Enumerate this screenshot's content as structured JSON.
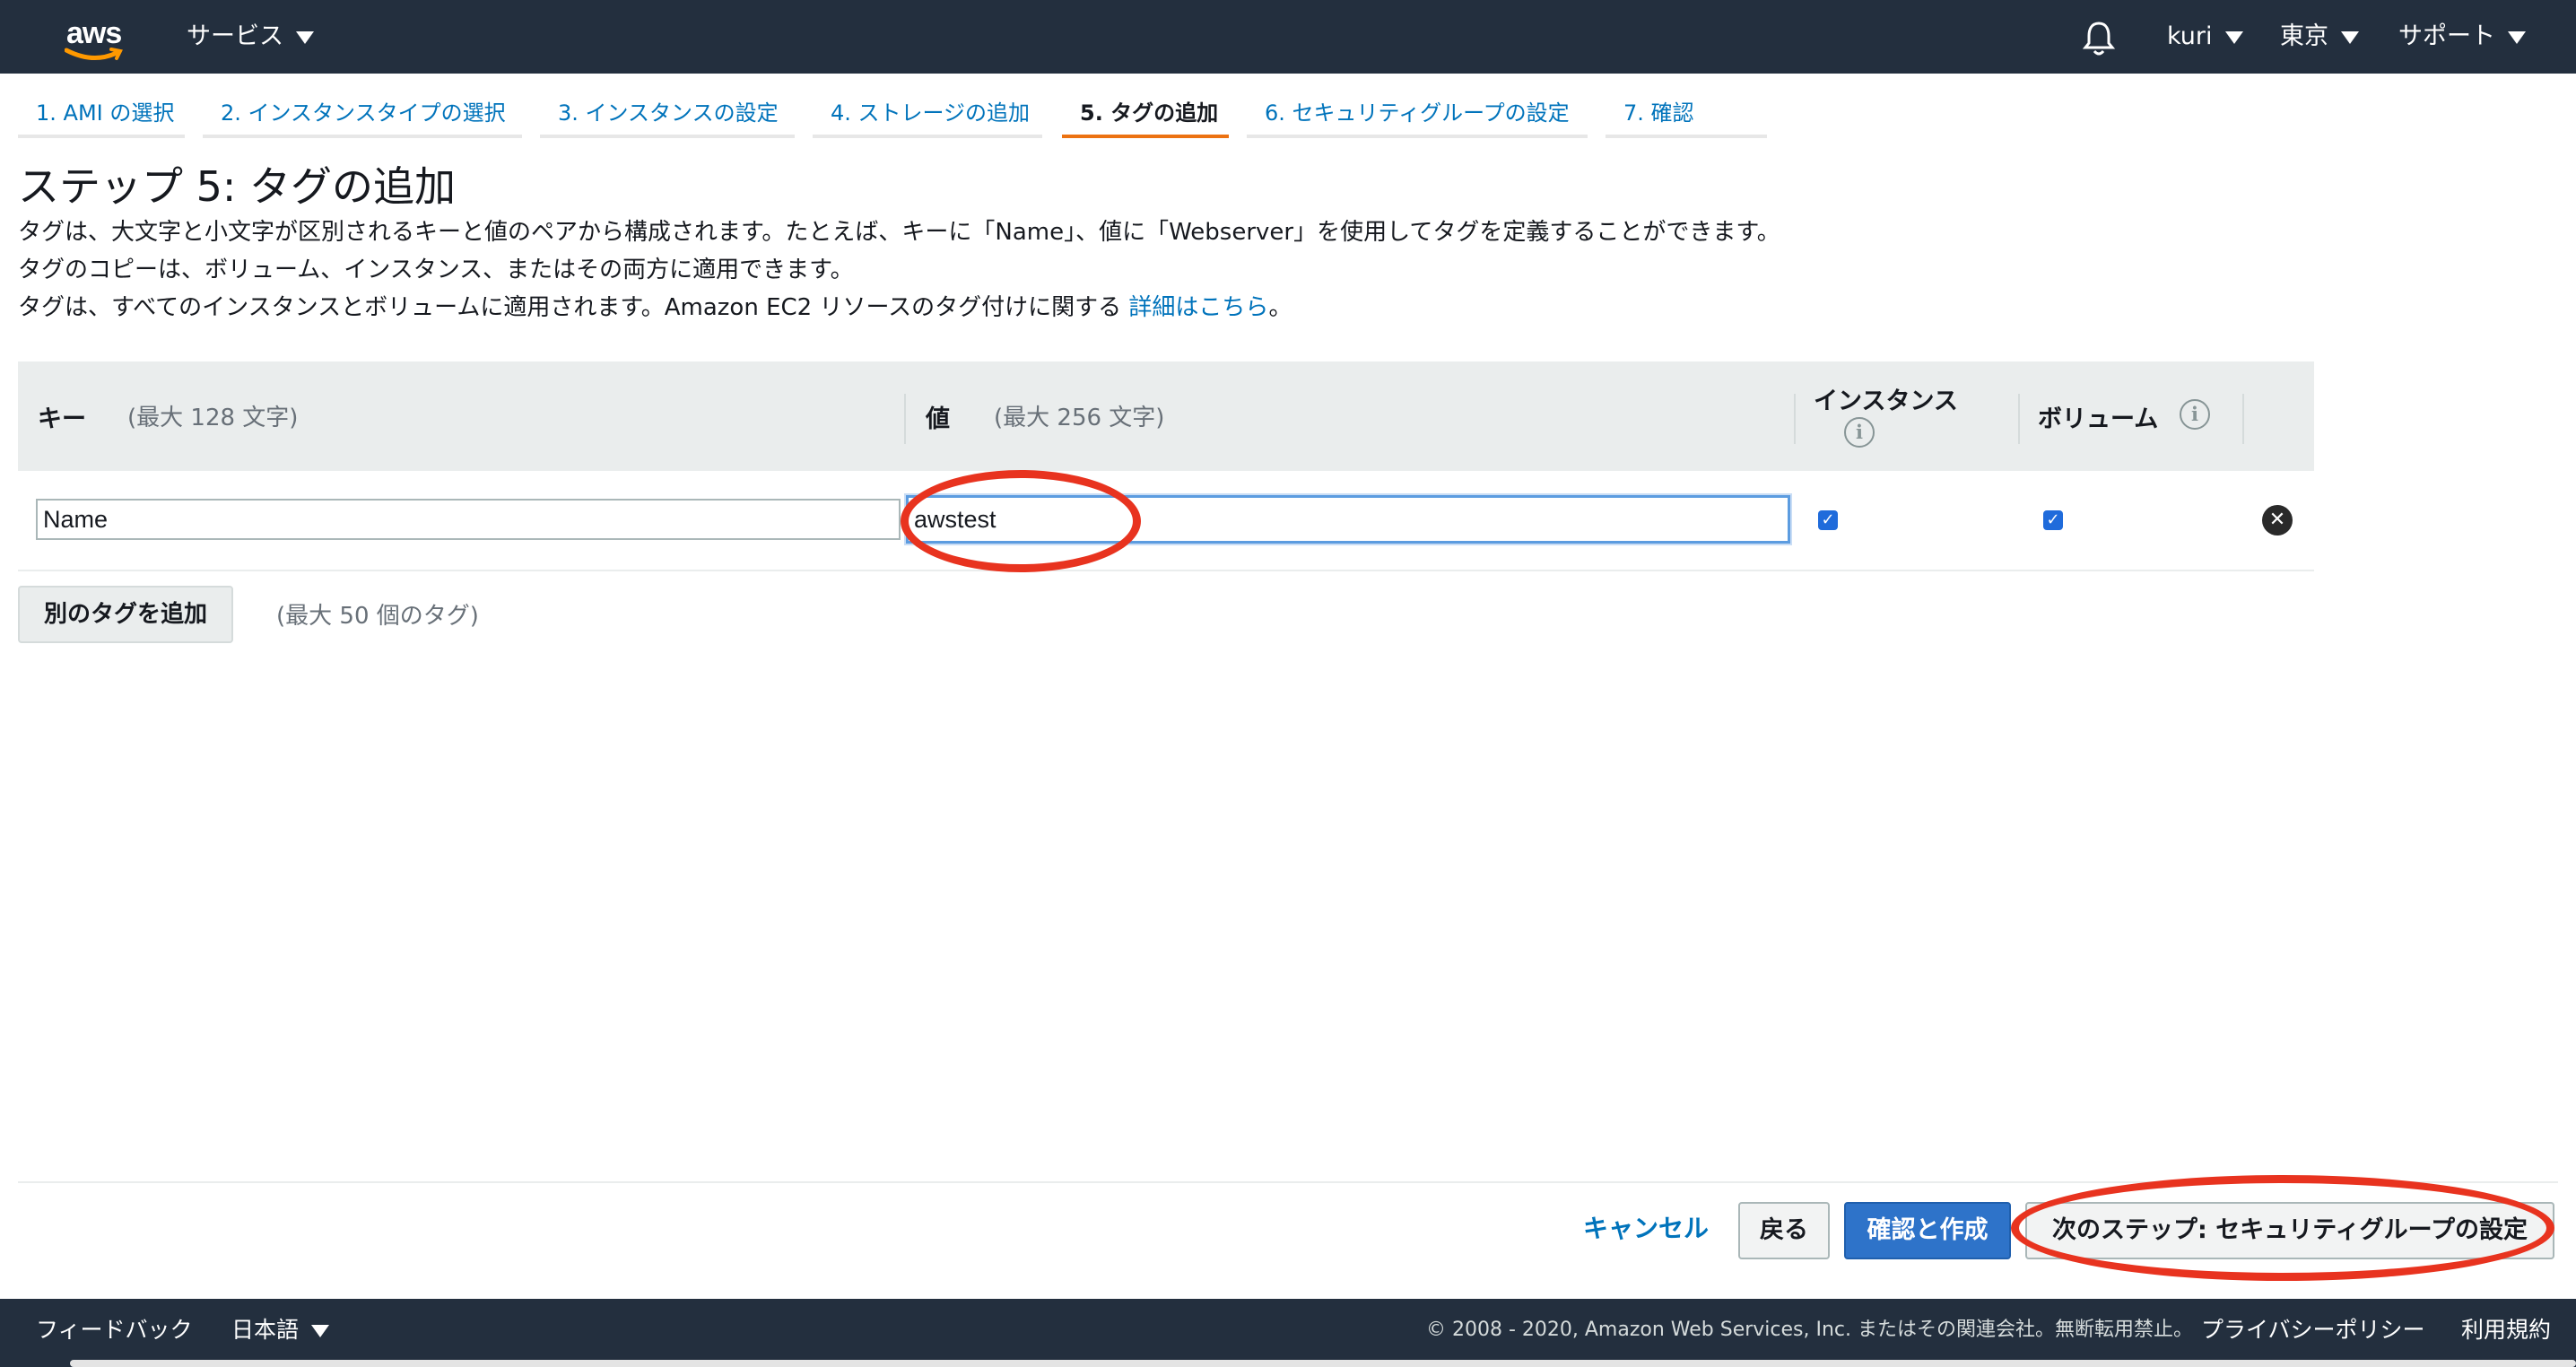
{
  "topbar": {
    "logo_text": "aws",
    "services_label": "サービス",
    "account_label": "kuri",
    "region_label": "東京",
    "support_label": "サポート",
    "icons": {
      "bell": "bell-icon",
      "logo": "aws-logo"
    },
    "colors": {
      "background": "#232f3e",
      "accent": "#ff9900"
    }
  },
  "steps": [
    {
      "label": "1. AMI の選択"
    },
    {
      "label": "2. インスタンスタイプの選択"
    },
    {
      "label": "3. インスタンスの設定"
    },
    {
      "label": "4. ストレージの追加"
    },
    {
      "label": "5. タグの追加",
      "active": true
    },
    {
      "label": "6. セキュリティグループの設定"
    },
    {
      "label": "7. 確認"
    }
  ],
  "page": {
    "title": "ステップ 5: タグの追加",
    "desc1": "タグは、大文字と小文字が区別されるキーと値のペアから構成されます。たとえば、キーに「Name」、値に「Webserver」を使用してタグを定義することができます。",
    "desc2": "タグのコピーは、ボリューム、インスタンス、またはその両方に適用できます。",
    "desc3": "タグは、すべてのインスタンスとボリュームに適用されます。Amazon EC2 リソースのタグ付けに関する ",
    "desc3_link": "詳細はこちら",
    "desc3_end": "。"
  },
  "table": {
    "key_header": "キー",
    "key_hint": "(最大 128 文字)",
    "value_header": "値",
    "value_hint": "(最大 256 文字)",
    "instance_header": "インスタンス",
    "volume_header": "ボリューム",
    "info_glyph": "i",
    "rows": [
      {
        "key": "Name",
        "value": "awstest",
        "instance": true,
        "volume": true
      }
    ],
    "check_glyph": "✓",
    "remove_glyph": "✕"
  },
  "add_tag": {
    "button_label": "別のタグを追加",
    "hint": "(最大 50 個のタグ)"
  },
  "actions": {
    "cancel": "キャンセル",
    "back": "戻る",
    "review_launch": "確認と作成",
    "next": "次のステップ: セキュリティグループの設定"
  },
  "footer": {
    "feedback": "フィードバック",
    "language": "日本語",
    "copyright": "© 2008 - 2020, Amazon Web Services, Inc. またはその関連会社。無断転用禁止。",
    "privacy": "プライバシーポリシー",
    "terms": "利用規約"
  },
  "colors": {
    "link": "#0073bb",
    "active_step_underline": "#ec7211",
    "primary_button": "#2e73c9",
    "highlight_ellipse": "#e8331f"
  }
}
